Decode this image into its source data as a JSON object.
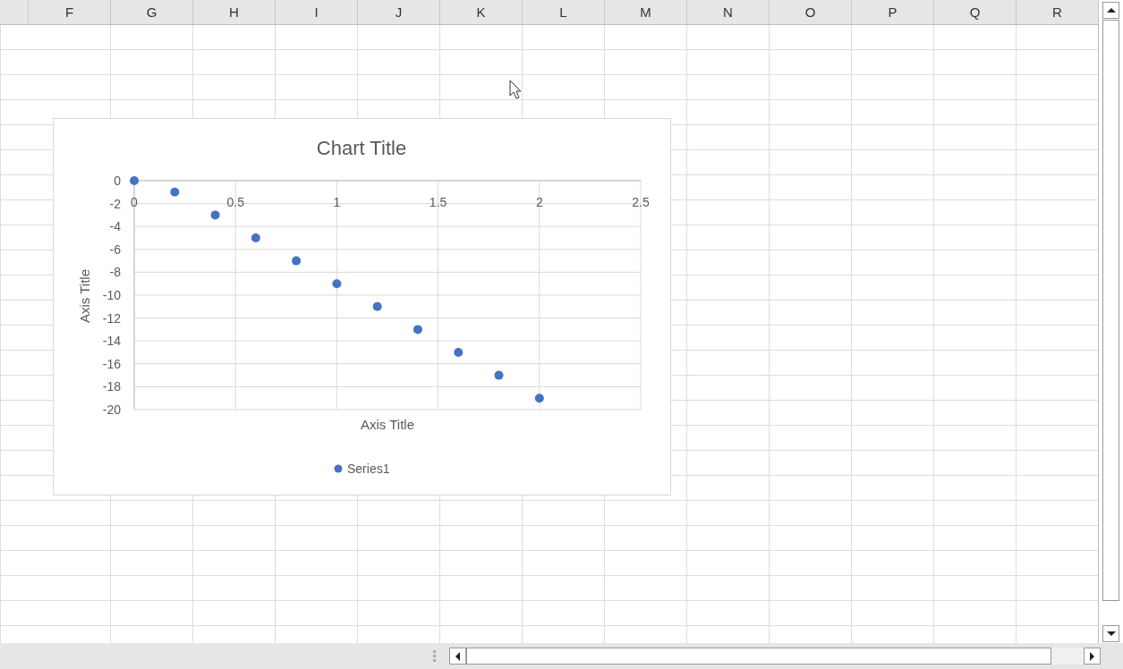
{
  "columns": [
    "F",
    "G",
    "H",
    "I",
    "J",
    "K",
    "L",
    "M",
    "N",
    "O",
    "P",
    "Q",
    "R"
  ],
  "chart": {
    "chart_data": {
      "type": "scatter",
      "title": "Chart Title",
      "xlabel": "Axis Title",
      "ylabel": "Axis Title",
      "x": [
        0,
        0.2,
        0.4,
        0.6,
        0.8,
        1,
        1.2,
        1.4,
        1.6,
        1.8,
        2
      ],
      "series": [
        {
          "name": "Series1",
          "color": "#4472c4",
          "values": [
            0,
            -1,
            -3,
            -5,
            -7,
            -9,
            -11,
            -13,
            -15,
            -17,
            -19
          ]
        }
      ],
      "xlim": [
        0,
        2.5
      ],
      "ylim": [
        -20,
        0
      ],
      "xticks": [
        0,
        0.5,
        1,
        1.5,
        2,
        2.5
      ],
      "yticks": [
        0,
        -2,
        -4,
        -6,
        -8,
        -10,
        -12,
        -14,
        -16,
        -18,
        -20
      ],
      "grid": true
    }
  }
}
